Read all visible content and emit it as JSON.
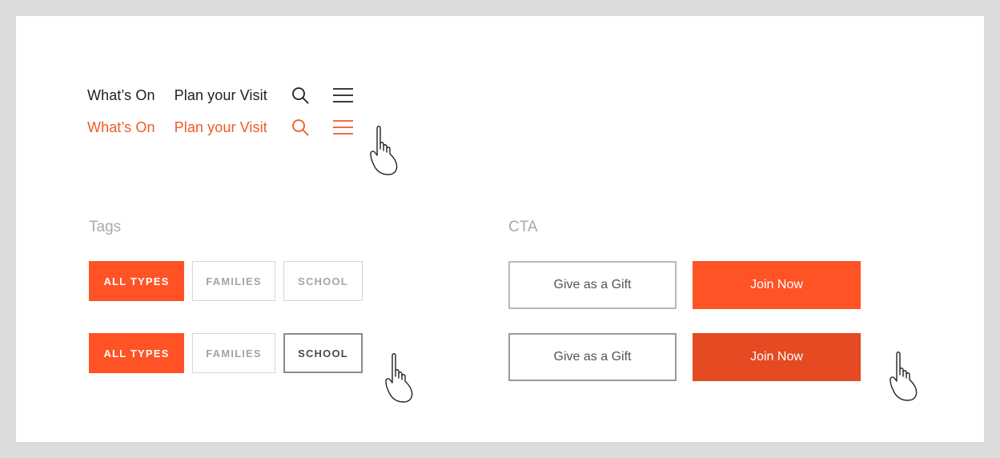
{
  "nav": {
    "whats_on": "What’s On",
    "plan_visit": "Plan your Visit",
    "default_color": "#1f1f1f",
    "hover_color": "#f05a28",
    "search_icon": "search-icon",
    "menu_icon": "hamburger-menu-icon"
  },
  "tags": {
    "title": "Tags",
    "all_types": "ALL TYPES",
    "families": "FAMILIES",
    "school": "SCHOOL"
  },
  "cta": {
    "title": "CTA",
    "gift": "Give as a Gift",
    "join": "Join Now",
    "accent": "#ff5325",
    "accent_hover": "#e54a22"
  },
  "cursor_icon": "hand-pointer-icon"
}
